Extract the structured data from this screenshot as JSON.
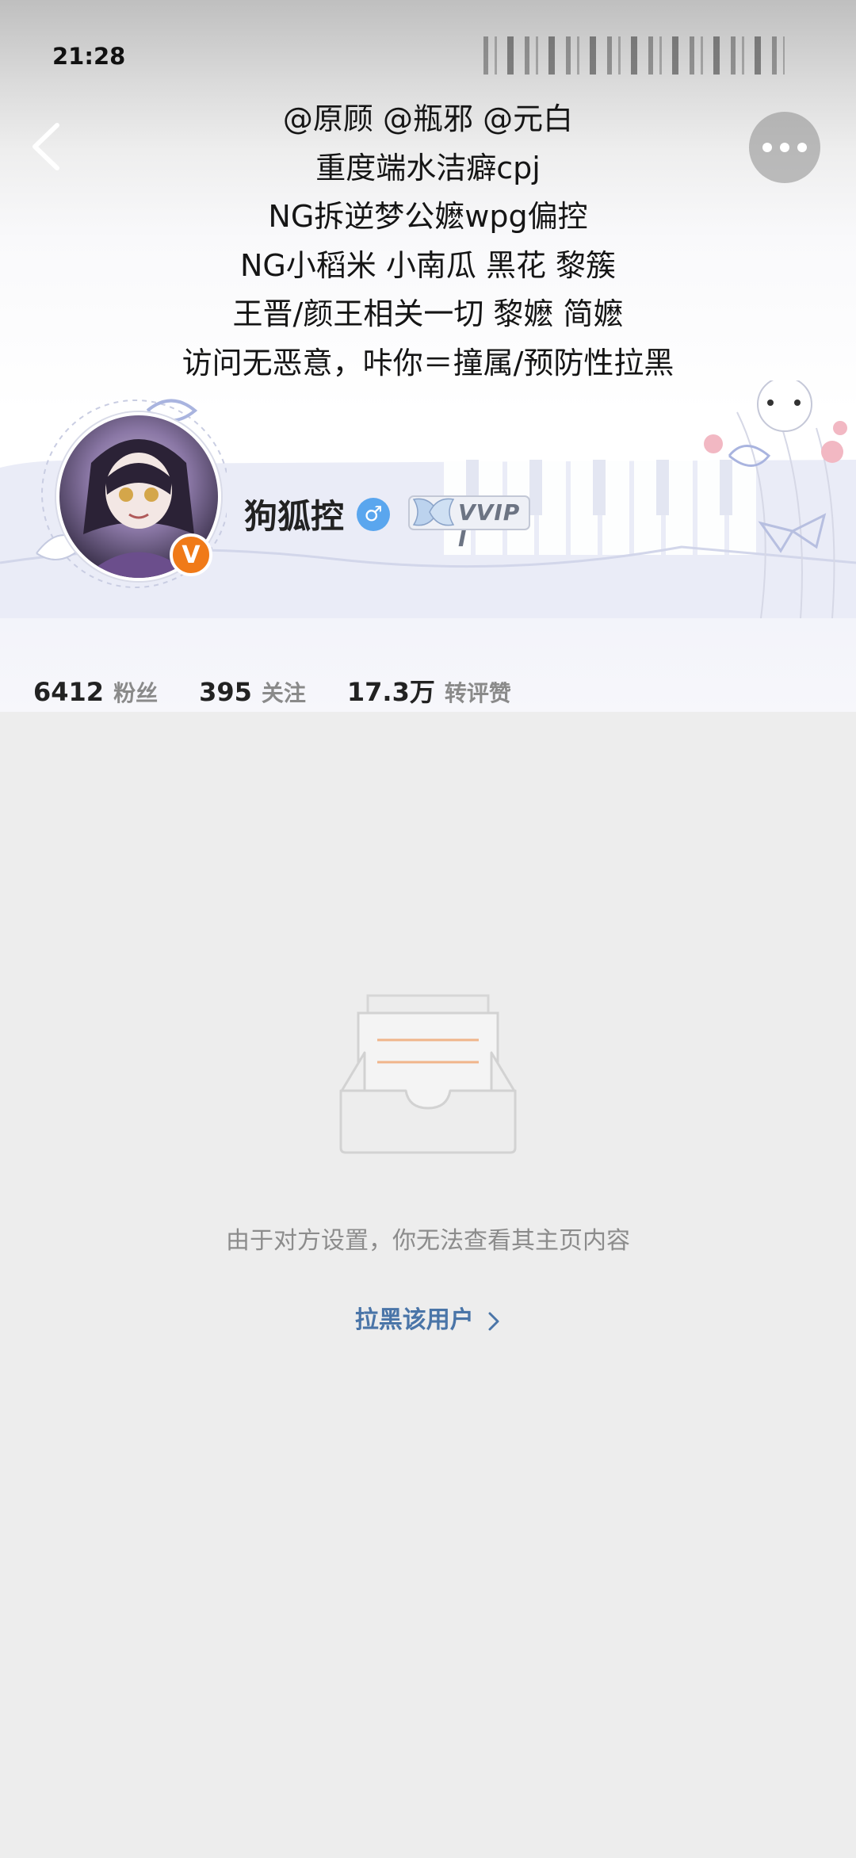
{
  "status_bar": {
    "time": "21:28"
  },
  "header": {
    "bio_lines": [
      "@原顾 @瓶邪 @元白",
      "重度端水洁癖cpj",
      "NG拆逆梦公嬷wpg偏控",
      "NG小稻米 小南瓜 黑花 黎簇",
      "王晋/颜王相关一切 黎嬷 简嬷",
      "访问无恶意，咔你＝撞属/预防性拉黑"
    ],
    "back_icon": "chevron-left-icon",
    "more_icon": "more-dots-icon"
  },
  "profile": {
    "username": "狗狐控",
    "gender_symbol": "♂",
    "verified_symbol": "V",
    "verified_color": "#f07a18",
    "vip_label": "VVIP I",
    "stats": [
      {
        "number": "6412",
        "label": "粉丝"
      },
      {
        "number": "395",
        "label": "关注"
      },
      {
        "number": "17.3万",
        "label": "转评赞"
      }
    ]
  },
  "content": {
    "empty_message": "由于对方设置，你无法查看其主页内容",
    "block_link": "拉黑该用户",
    "link_color": "#4a75a8"
  }
}
